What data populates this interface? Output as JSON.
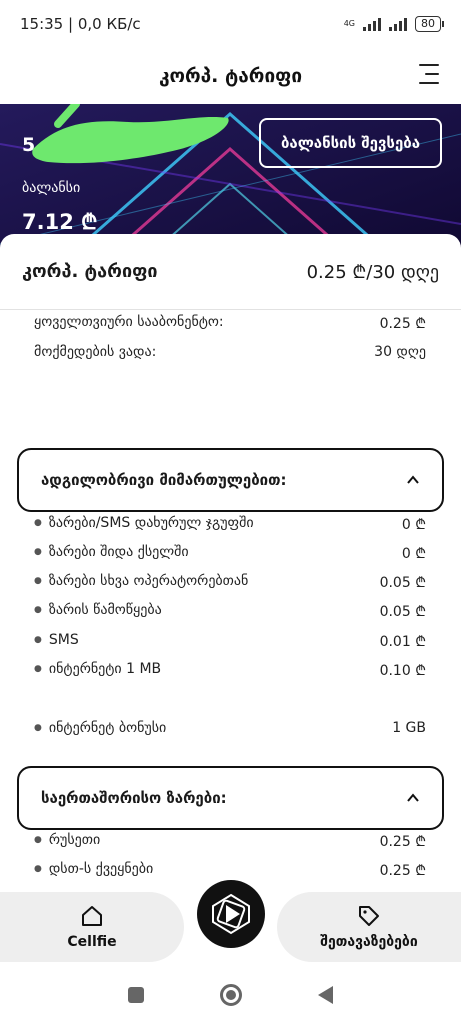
{
  "status_bar": {
    "time_network": "15:35 | 0,0 КБ/с",
    "network_type": "4G",
    "battery": "80"
  },
  "header": {
    "title": "კორპ. ტარიფი"
  },
  "banner": {
    "phone_number": "5",
    "topup_button": "ბალანსის შევსება",
    "balance_label": "ბალანსი",
    "balance_value": "7.12 ₾"
  },
  "plan": {
    "name": "კორპ. ტარიფი",
    "price": "0.25 ₾/30 დღე",
    "details": [
      {
        "label": "ყოველთვიური სააბონენტო:",
        "value": "0.25 ₾"
      },
      {
        "label": "მოქმედების ვადა:",
        "value": "30 დღე"
      }
    ]
  },
  "local_section": {
    "title": "ადგილობრივი მიმართულებით:",
    "items": [
      {
        "label": "ზარები/SMS დახურულ ჯგუფში",
        "value": "0 ₾"
      },
      {
        "label": "ზარები შიდა ქსელში",
        "value": "0 ₾"
      },
      {
        "label": "ზარები სხვა ოპერატორებთან",
        "value": "0.05 ₾"
      },
      {
        "label": "ზარის წამოწყება",
        "value": "0.05 ₾"
      },
      {
        "label": "SMS",
        "value": "0.01 ₾"
      },
      {
        "label": "ინტერნეტი 1 MB",
        "value": "0.10 ₾"
      },
      {
        "label": "ინტერნეტ ბონუსი",
        "value": "1 GB"
      }
    ]
  },
  "intl_section": {
    "title": "საერთაშორისო ზარები:",
    "items": [
      {
        "label": "რუსეთი",
        "value": "0.25 ₾"
      },
      {
        "label": "დსთ-ს ქვეყნები",
        "value": "0.25 ₾"
      }
    ]
  },
  "bottom_nav": {
    "left_label": "Cellfie",
    "right_label": "შეთავაზებები"
  },
  "colors": {
    "banner_bg": "#1c1044",
    "redaction": "#6ee86e",
    "accent": "#111111"
  }
}
